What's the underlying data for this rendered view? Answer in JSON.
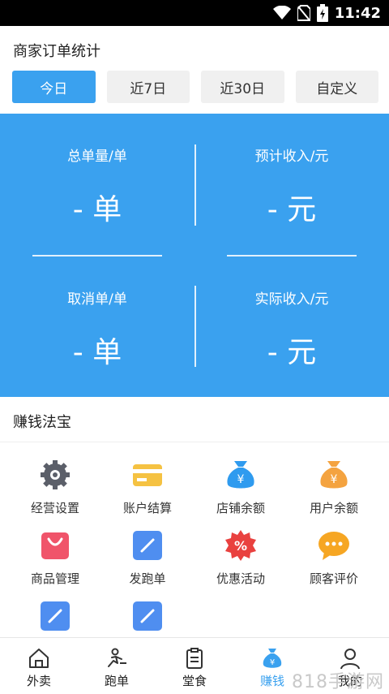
{
  "status_bar": {
    "time": "11:42"
  },
  "order_stats": {
    "title": "商家订单统计",
    "tabs": [
      "今日",
      "近7日",
      "近30日",
      "自定义"
    ],
    "active_tab": 0,
    "cells": [
      {
        "label": "总单量/单",
        "value": "- 单"
      },
      {
        "label": "预计收入/元",
        "value": "- 元"
      },
      {
        "label": "取消单/单",
        "value": "- 单"
      },
      {
        "label": "实际收入/元",
        "value": "- 元"
      }
    ]
  },
  "tools": {
    "title": "赚钱法宝",
    "items": [
      {
        "label": "经营设置",
        "icon": "gear-icon"
      },
      {
        "label": "账户结算",
        "icon": "card-icon"
      },
      {
        "label": "店铺余额",
        "icon": "money-bag-icon"
      },
      {
        "label": "用户余额",
        "icon": "money-bag-icon"
      },
      {
        "label": "商品管理",
        "icon": "shopping-bag-icon"
      },
      {
        "label": "发跑单",
        "icon": "edit-icon"
      },
      {
        "label": "优惠活动",
        "icon": "discount-icon"
      },
      {
        "label": "顾客评价",
        "icon": "chat-icon"
      },
      {
        "label": "",
        "icon": "edit-icon"
      },
      {
        "label": "",
        "icon": "edit-icon"
      }
    ]
  },
  "bottom_nav": {
    "items": [
      {
        "label": "外卖",
        "icon": "home-icon"
      },
      {
        "label": "跑单",
        "icon": "runner-icon"
      },
      {
        "label": "堂食",
        "icon": "clipboard-icon"
      },
      {
        "label": "赚钱",
        "icon": "money-bag-icon"
      },
      {
        "label": "我的",
        "icon": "user-icon"
      }
    ],
    "active": 3
  },
  "watermark": "818手游网",
  "colors": {
    "primary": "#3aa1ef",
    "gear": "#5b5f69",
    "card": "#f5c242",
    "bag_blue": "#2f9bef",
    "bag_orange": "#f4a340",
    "shopping": "#f0546a",
    "edit": "#4f8ef0",
    "discount": "#e9413f",
    "chat": "#f6a623"
  }
}
